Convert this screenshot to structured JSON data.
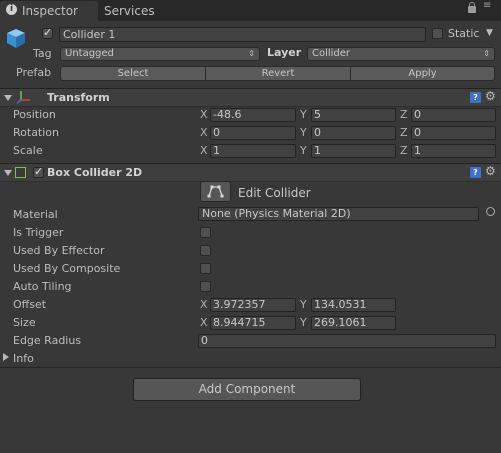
{
  "tabs": {
    "inspector": "Inspector",
    "services": "Services"
  },
  "header": {
    "name": "Collider 1",
    "static_label": "Static",
    "tag_label": "Tag",
    "tag_value": "Untagged",
    "layer_label": "Layer",
    "layer_value": "Collider",
    "prefab_label": "Prefab",
    "select": "Select",
    "revert": "Revert",
    "apply": "Apply"
  },
  "transform": {
    "title": "Transform",
    "position_label": "Position",
    "rotation_label": "Rotation",
    "scale_label": "Scale",
    "position": {
      "x": "-48.6",
      "y": "5",
      "z": "0"
    },
    "rotation": {
      "x": "0",
      "y": "0",
      "z": "0"
    },
    "scale": {
      "x": "1",
      "y": "1",
      "z": "1"
    }
  },
  "axes": {
    "x": "X",
    "y": "Y",
    "z": "Z"
  },
  "box_collider": {
    "title": "Box Collider 2D",
    "edit_collider": "Edit Collider",
    "material_label": "Material",
    "material_value": "None (Physics Material 2D)",
    "is_trigger_label": "Is Trigger",
    "used_by_effector_label": "Used By Effector",
    "used_by_composite_label": "Used By Composite",
    "auto_tiling_label": "Auto Tiling",
    "offset_label": "Offset",
    "offset": {
      "x": "3.972357",
      "y": "134.0531"
    },
    "size_label": "Size",
    "size": {
      "x": "8.944715",
      "y": "269.1061"
    },
    "edge_radius_label": "Edge Radius",
    "edge_radius_value": "0",
    "info_label": "Info"
  },
  "footer": {
    "add_component": "Add Component"
  },
  "icons": {
    "inspector_tab": "info-icon",
    "lock": "lock-icon",
    "tab_menu": "menu-icon",
    "gameobject": "cube-icon",
    "transform": "transform-gizmo-icon",
    "help": "help-book-icon",
    "settings": "gear-icon",
    "box_collider": "box-collider-icon",
    "edit_collider": "edit-collider-icon",
    "object_picker": "object-picker-icon"
  },
  "colors": {
    "background": "#383838",
    "tab_bar": "#282828",
    "header": "#3e3e3e",
    "help_icon": "#3d70c8"
  }
}
